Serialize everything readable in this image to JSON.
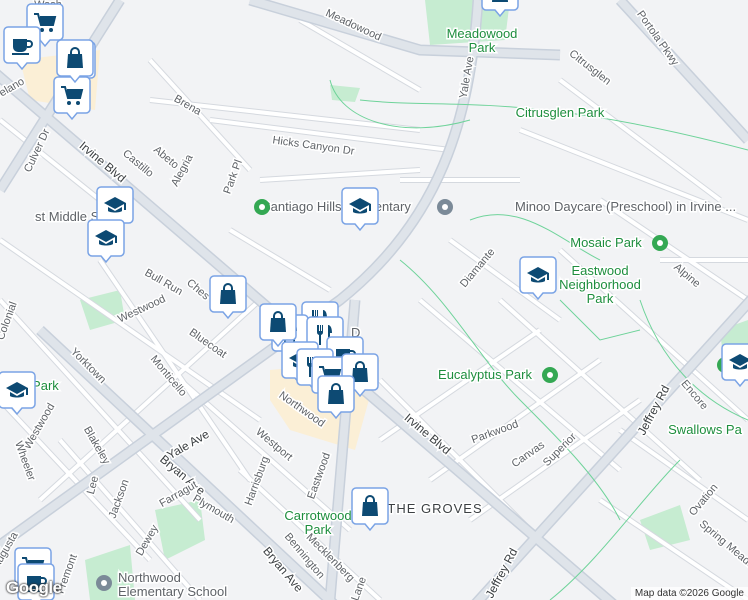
{
  "labels": {
    "wash": "Wash",
    "meadowood": "Meadowood",
    "meadowood_park": [
      "Meadowood",
      "Park"
    ],
    "portola_pkwy": "Portola Pkwy",
    "yale_ave_n": "Yale Ave",
    "citrusglen": "Citrusglen",
    "citrusglen_park": "Citrusglen Park",
    "brena": "Brena",
    "delano": "Delano",
    "culver_dr": "Culver Dr",
    "castillo": "Castillo",
    "abeto": "Abeto",
    "alegria": "Alegria",
    "irvine_blvd_w": "Irvine Blvd",
    "park_pl": "Park Pl",
    "hicks_canyon": "Hicks Canyon Dr",
    "santiago_hills": "Santiago Hills Elementary",
    "minoo_daycare": "Minoo Daycare (Preschool) in Irvine ...",
    "middle_school": "st Middle School",
    "diamante": "Diamante",
    "mosaic_park": "Mosaic Park",
    "eastwood_park": [
      "Eastwood",
      "Neighborhood",
      "Park"
    ],
    "alpine": "Alpine",
    "bull_run": "Bull Run",
    "ches": "Ches",
    "westwood_n": "Westwood",
    "colonial": "Colonial",
    "bluecoat": "Bluecoat",
    "yorktown": "Yorktown",
    "monticello": "Monticello",
    "d": "D",
    "eucalyptus_park": "Eucalyptus Park",
    "northwood": "Northwood",
    "irvine_blvd_e": "Irvine Blvd",
    "jeffrey_rd_n": "Jeffrey Rd",
    "encore": "Encore",
    "swallows_park": "Swallows Pa",
    "westwood_s": "Westwood",
    "blakeley": "Blakeley",
    "wheeler": "Wheeler",
    "yale_ave_s": "Yale Ave",
    "westport": "Westport",
    "parkwood": "Parkwood",
    "canvas": "Canvas",
    "superior": "Superior",
    "bryan_ave_w": "Bryan Ave",
    "harrisburg": "Harrisburg",
    "eastwood": "Eastwood",
    "lee": "Lee",
    "jackson": "Jackson",
    "plymouth": "Plymouth",
    "farragut": "Farragut",
    "dewey": "Dewey",
    "the_groves": "THE GROVES",
    "carrotwood_park": [
      "Carrotwood",
      "Park"
    ],
    "ovation": "Ovation",
    "spring_meado": "Spring Meado",
    "bennington": "Bennington",
    "mecklenberg": "Mecklenberg",
    "bryan_ave_s": "Bryan Ave",
    "lane": "Lane",
    "jeffrey_rd_s": "Jeffrey Rd",
    "augusta": "Augusta",
    "fremont": "Fremont",
    "park_w": "d Park",
    "northwood_elem": [
      "Northwood",
      "Elementary School"
    ]
  },
  "markers": [
    "shopping-bag",
    "shopping-cart",
    "coffee",
    "shopping-bag",
    "shopping-cart",
    "school",
    "school",
    "shopping-bag",
    "school",
    "school",
    "school",
    "shopping-bag",
    "restaurant",
    "restaurant",
    "restaurant",
    "school",
    "coffee",
    "restaurant",
    "shopping-cart",
    "shopping-bag",
    "shopping-bag",
    "shopping-bag",
    "shopping-cart",
    "coffee",
    "school",
    "shopping-bag"
  ],
  "attribution": "Map data ©2026 Google",
  "logo": "Google",
  "colors": {
    "marker_border": "#7aa3e5",
    "marker_icon": "#0d4a73",
    "park": "#c6ecd1",
    "park_text": "#1e8e3e"
  }
}
